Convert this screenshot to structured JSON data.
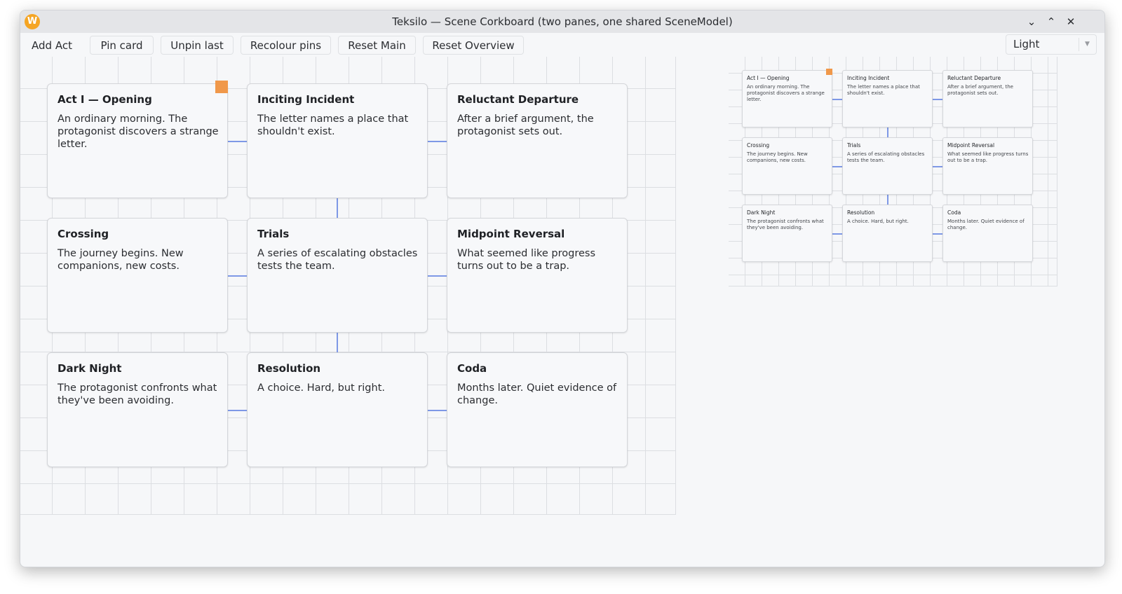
{
  "window": {
    "title": "Teksilo — Scene Corkboard (two panes, one shared SceneModel)",
    "app_icon_glyph": "W",
    "controls": [
      "chevron-down-icon",
      "chevron-up-icon",
      "close-icon"
    ]
  },
  "toolbar": {
    "buttons": [
      "Add Act",
      "Pin card",
      "Unpin last",
      "Recolour pins",
      "Reset Main",
      "Reset Overview"
    ],
    "theme": {
      "value": "Light"
    }
  },
  "colors": {
    "pin": "#f0984a",
    "connector": "#7e98e6",
    "app_icon": "#f5a524"
  },
  "cards": [
    {
      "title": "Act I — Opening",
      "body": "An ordinary morning. The protagonist discovers a strange letter.",
      "pinned": true
    },
    {
      "title": "Inciting Incident",
      "body": "The letter names a place that shouldn't exist.",
      "pinned": false
    },
    {
      "title": "Reluctant Departure",
      "body": "After a brief argument, the protagonist sets out.",
      "pinned": false
    },
    {
      "title": "Crossing",
      "body": "The journey begins. New companions, new costs.",
      "pinned": false
    },
    {
      "title": "Trials",
      "body": "A series of escalating obstacles tests the team.",
      "pinned": false
    },
    {
      "title": "Midpoint Reversal",
      "body": "What seemed like progress turns out to be a trap.",
      "pinned": false
    },
    {
      "title": "Dark Night",
      "body": "The protagonist confronts what they've been avoiding.",
      "pinned": false
    },
    {
      "title": "Resolution",
      "body": "A choice. Hard, but right.",
      "pinned": false
    },
    {
      "title": "Coda",
      "body": "Months later. Quiet evidence of change.",
      "pinned": false
    }
  ]
}
